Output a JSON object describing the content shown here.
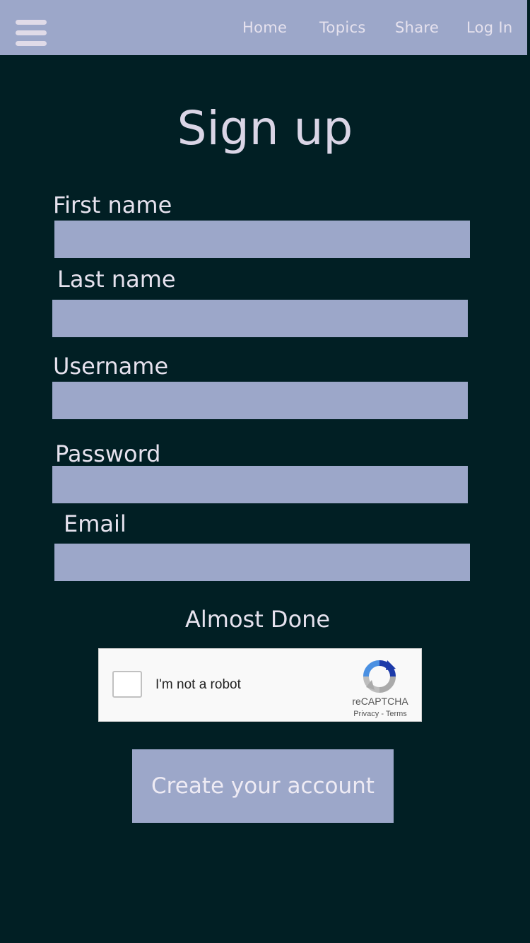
{
  "nav": {
    "menu_icon": "hamburger-menu-icon",
    "links": [
      "Home",
      "Topics",
      "Share",
      "Log In"
    ]
  },
  "form": {
    "title": "Sign up",
    "fields": {
      "first_name": {
        "label": "First name",
        "value": ""
      },
      "last_name": {
        "label": "Last name",
        "value": ""
      },
      "username": {
        "label": "Username",
        "value": ""
      },
      "password": {
        "label": "Password",
        "value": ""
      },
      "email": {
        "label": "Email",
        "value": ""
      }
    },
    "almost_done": "Almost Done",
    "captcha": {
      "checkbox_label": "I'm not a robot",
      "brand": "reCAPTCHA",
      "links": "Privacy - Terms",
      "logo_icon": "recaptcha-logo-icon"
    },
    "submit_label": "Create your account"
  },
  "colors": {
    "background": "#011f24",
    "accent": "#9ca7c9",
    "text": "#e6e2ee"
  }
}
